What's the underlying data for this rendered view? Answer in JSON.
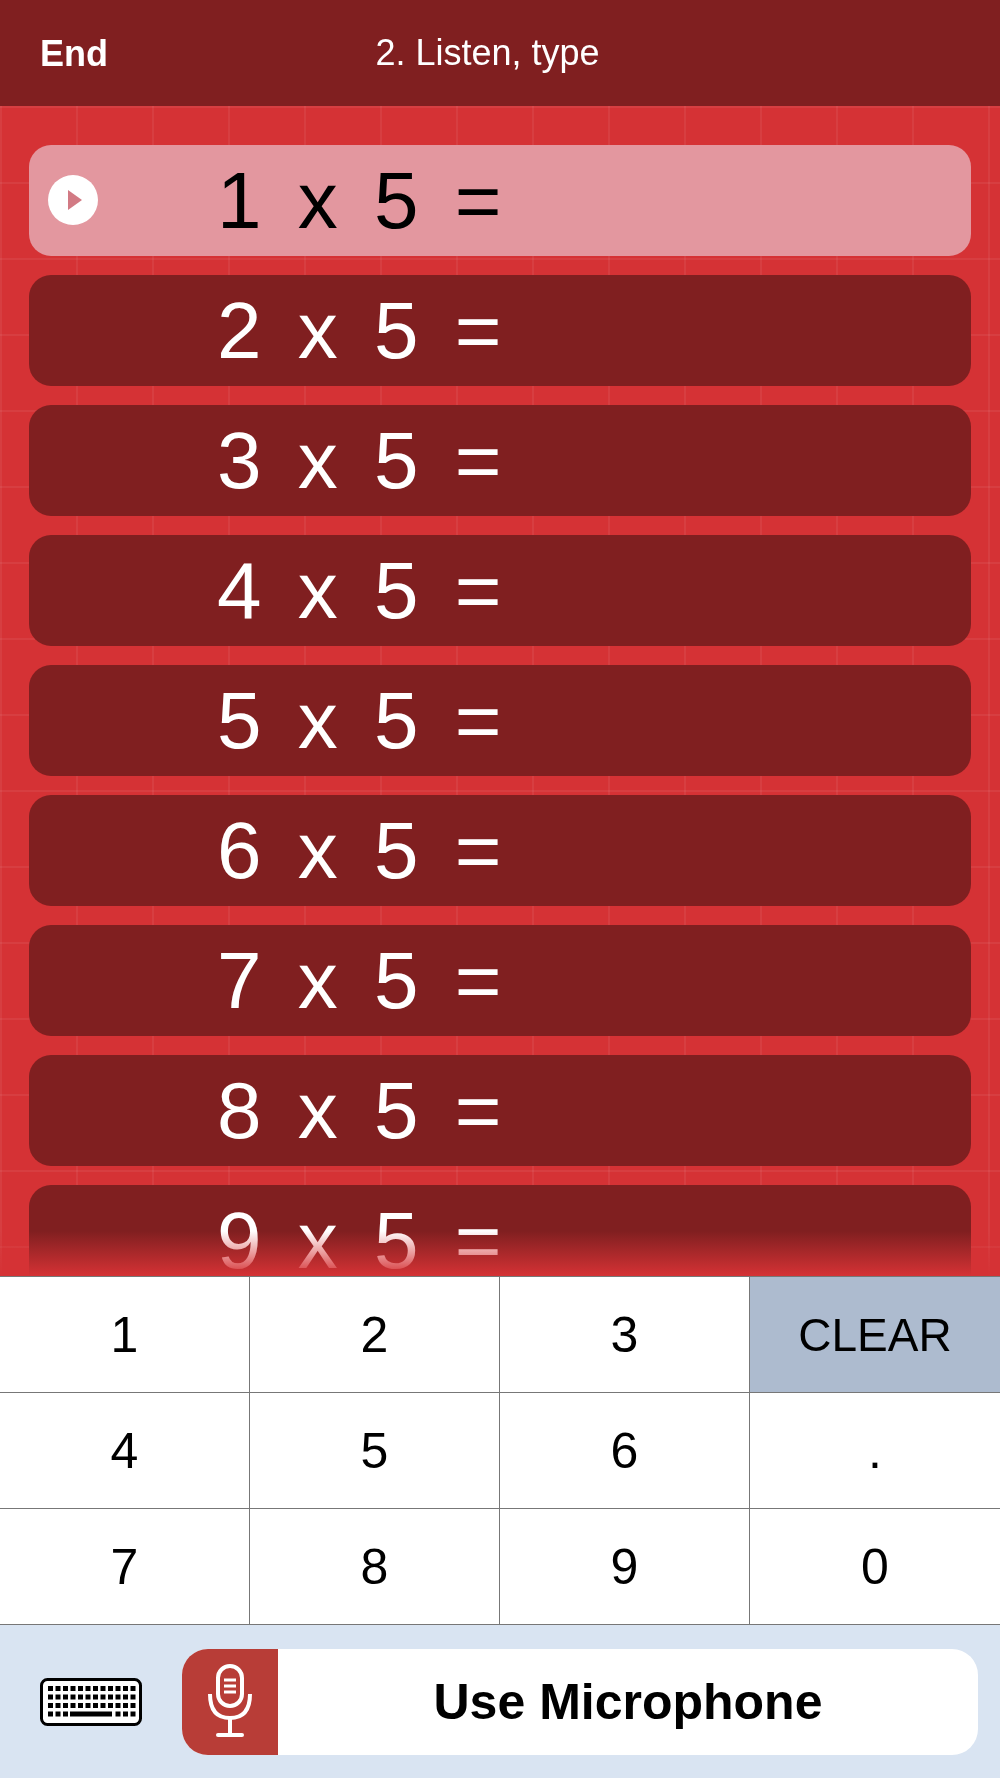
{
  "header": {
    "back_button": "End",
    "title": "2. Listen, type"
  },
  "questions": [
    {
      "text": "1 x 5 =",
      "selected": true
    },
    {
      "text": "2 x 5 =",
      "selected": false
    },
    {
      "text": "3 x 5 =",
      "selected": false
    },
    {
      "text": "4 x 5 =",
      "selected": false
    },
    {
      "text": "5 x 5 =",
      "selected": false
    },
    {
      "text": "6 x 5 =",
      "selected": false
    },
    {
      "text": "7 x 5 =",
      "selected": false
    },
    {
      "text": "8 x 5 =",
      "selected": false
    },
    {
      "text": "9 x 5 =",
      "selected": false
    }
  ],
  "keypad": [
    {
      "label": "1",
      "kind": "digit"
    },
    {
      "label": "2",
      "kind": "digit"
    },
    {
      "label": "3",
      "kind": "digit"
    },
    {
      "label": "CLEAR",
      "kind": "clear"
    },
    {
      "label": "4",
      "kind": "digit"
    },
    {
      "label": "5",
      "kind": "digit"
    },
    {
      "label": "6",
      "kind": "digit"
    },
    {
      "label": ".",
      "kind": "digit"
    },
    {
      "label": "7",
      "kind": "digit"
    },
    {
      "label": "8",
      "kind": "digit"
    },
    {
      "label": "9",
      "kind": "digit"
    },
    {
      "label": "0",
      "kind": "digit"
    }
  ],
  "microphone_button": "Use Microphone"
}
